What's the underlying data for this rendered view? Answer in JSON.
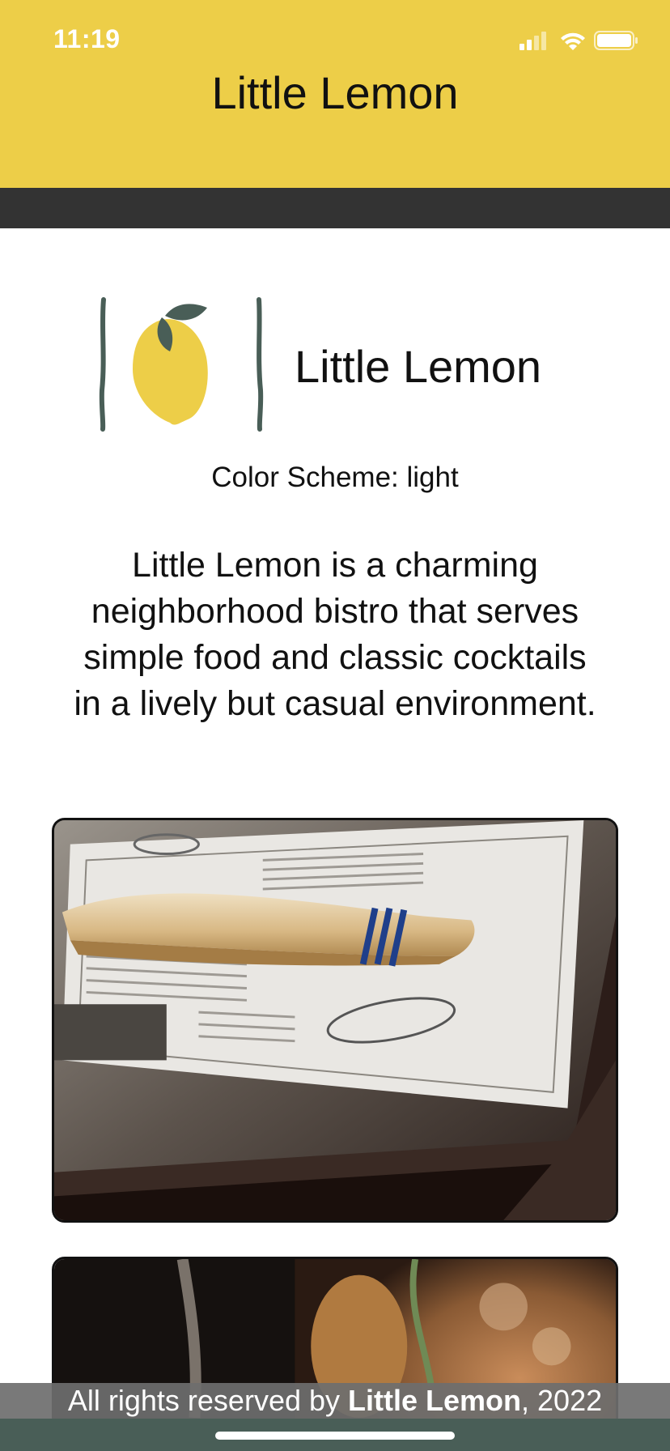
{
  "status_bar": {
    "time": "11:19",
    "icons": [
      "signal-icon",
      "wifi-icon",
      "battery-icon"
    ]
  },
  "header": {
    "title": "Little Lemon"
  },
  "logo": {
    "icon": "lemon-logo-icon",
    "title": "Little Lemon"
  },
  "color_scheme_text": "Color Scheme: light",
  "description": "Little Lemon is a charming neighborhood bistro that serves simple food and classic cocktails in a lively but casual environment.",
  "photos": [
    {
      "icon": "restaurant-table-photo"
    },
    {
      "icon": "food-dish-photo"
    }
  ],
  "footer": {
    "prefix": "All rights reserved by ",
    "brand": "Little Lemon",
    "suffix": ", 2022"
  },
  "colors": {
    "header_yellow": "#EDCE48",
    "nav_dark": "#333333",
    "brand_green": "#495E57",
    "lemon_yellow": "#EDCE48"
  }
}
